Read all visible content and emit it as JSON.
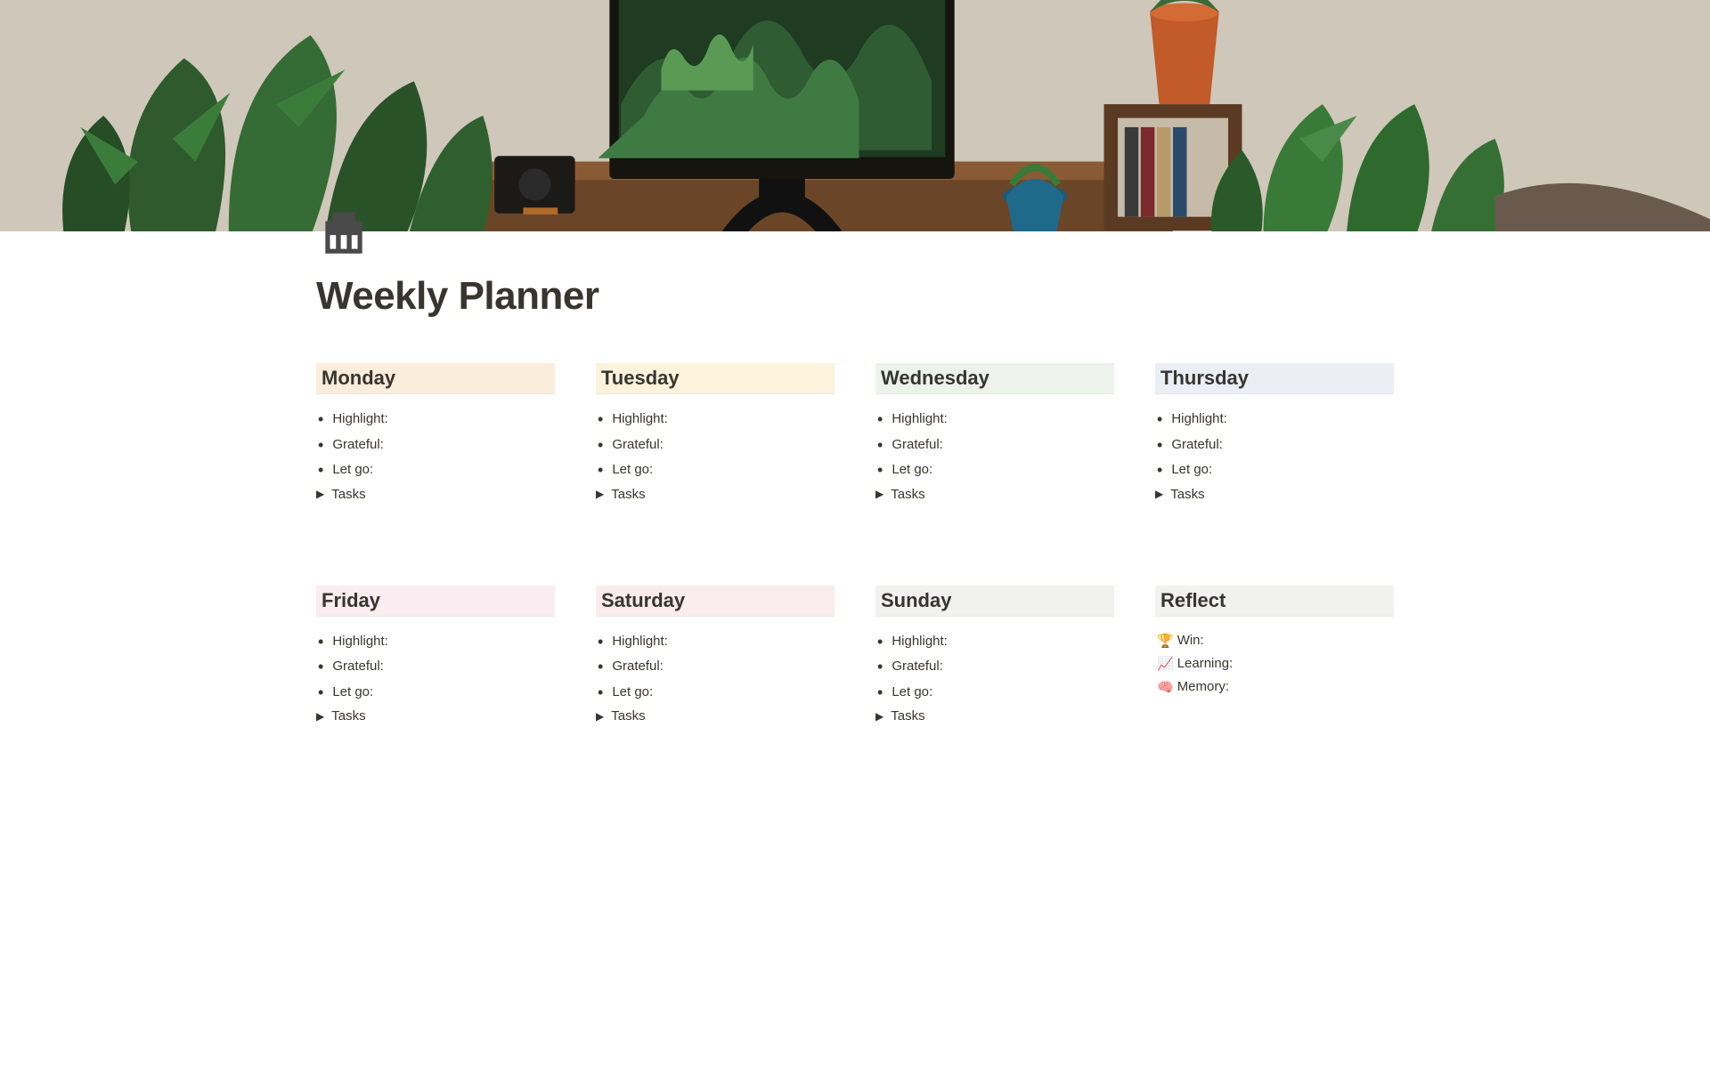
{
  "page": {
    "title": "Weekly Planner"
  },
  "labels": {
    "highlight": "Highlight:",
    "grateful": "Grateful:",
    "letgo": "Let go:",
    "tasks": "Tasks"
  },
  "days": {
    "monday": {
      "label": "Monday"
    },
    "tuesday": {
      "label": "Tuesday"
    },
    "wednesday": {
      "label": "Wednesday"
    },
    "thursday": {
      "label": "Thursday"
    },
    "friday": {
      "label": "Friday"
    },
    "saturday": {
      "label": "Saturday"
    },
    "sunday": {
      "label": "Sunday"
    }
  },
  "reflect": {
    "label": "Reflect",
    "win_emoji": "🏆",
    "win_label": "Win:",
    "learning_emoji": "📈",
    "learning_label": "Learning:",
    "memory_emoji": "🧠",
    "memory_label": "Memory:"
  }
}
